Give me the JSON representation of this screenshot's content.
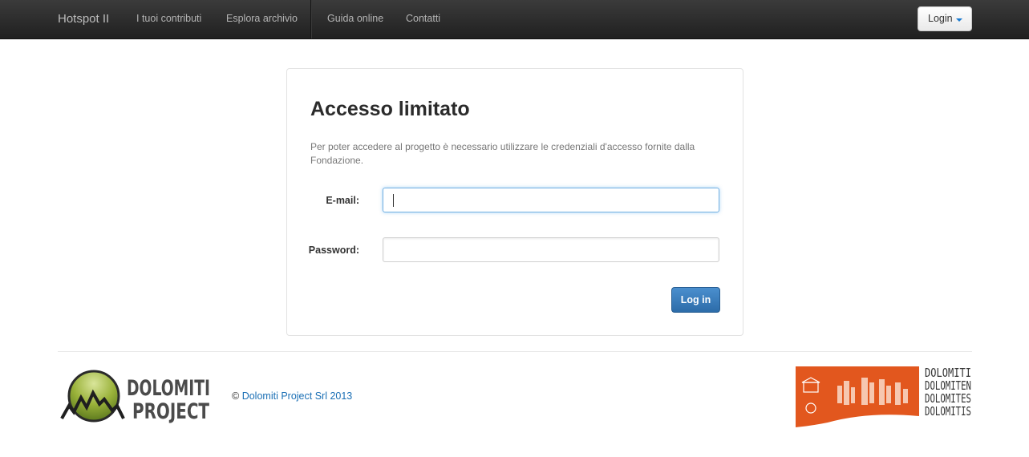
{
  "navbar": {
    "brand": "Hotspot II",
    "links": [
      "I tuoi contributi",
      "Esplora archivio",
      "Guida online",
      "Contatti"
    ],
    "login_label": "Login"
  },
  "login_card": {
    "title": "Accesso limitato",
    "description": "Per poter accedere al progetto è necessario utilizzare le credenziali d'accesso fornite dalla Fondazione.",
    "email_label": "E-mail:",
    "email_value": "",
    "password_label": "Password:",
    "password_value": "",
    "submit_label": "Log in"
  },
  "footer": {
    "copyright_symbol": "©",
    "copyright_link": "Dolomiti Project Srl 2013",
    "logo_left_text": [
      "DOLOMITI",
      "PROJECT"
    ],
    "logo_right_words": [
      "DOLOMITI",
      "DOLOMITEN",
      "DOLOMITES",
      "DOLOMITIS"
    ]
  },
  "colors": {
    "navbar": "#2c2c2c",
    "accent": "#2d6ca9",
    "link": "#1a6fb5",
    "unesco_orange": "#e2571e",
    "logo_green": "#9ab23a"
  }
}
